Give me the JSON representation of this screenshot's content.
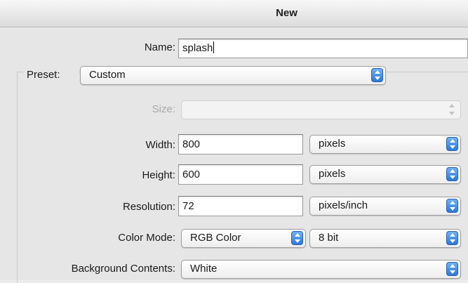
{
  "window": {
    "title": "New"
  },
  "form": {
    "name": {
      "label": "Name:",
      "value": "splash"
    },
    "preset": {
      "label": "Preset:",
      "value": "Custom"
    },
    "size": {
      "label": "Size:",
      "value": ""
    },
    "width": {
      "label": "Width:",
      "value": "800",
      "unit": "pixels"
    },
    "height": {
      "label": "Height:",
      "value": "600",
      "unit": "pixels"
    },
    "resolution": {
      "label": "Resolution:",
      "value": "72",
      "unit": "pixels/inch"
    },
    "color_mode": {
      "label": "Color Mode:",
      "value": "RGB Color",
      "depth": "8 bit"
    },
    "background": {
      "label": "Background Contents:",
      "value": "White"
    }
  }
}
